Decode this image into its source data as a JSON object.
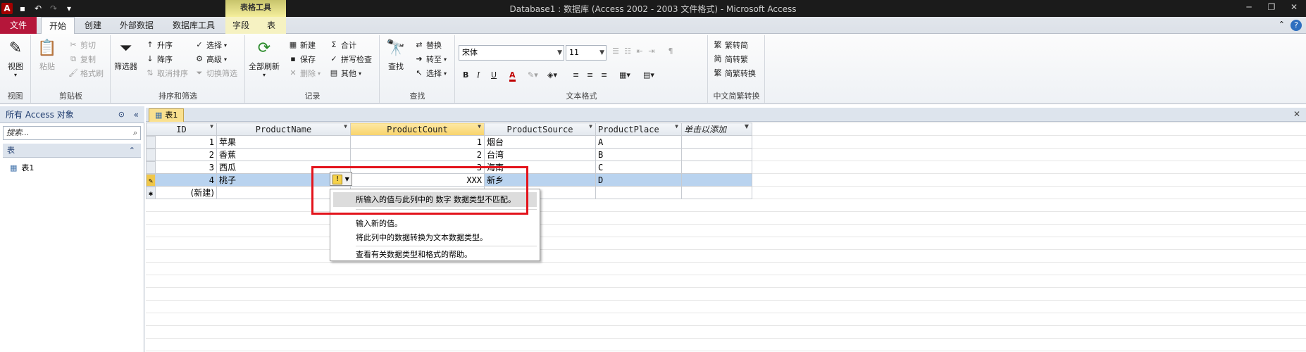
{
  "window": {
    "title": "Database1 : 数据库 (Access 2002 - 2003 文件格式) - Microsoft Access",
    "context_tool": "表格工具"
  },
  "quick_access": {
    "app_icon": "A",
    "icons": [
      "save-icon",
      "undo-icon",
      "redo-icon",
      "customize-icon"
    ]
  },
  "tabs": [
    "文件",
    "开始",
    "创建",
    "外部数据",
    "数据库工具",
    "字段",
    "表"
  ],
  "ribbon": {
    "view": {
      "label": "视图",
      "group": "视图"
    },
    "clipboard": {
      "paste": "粘贴",
      "cut": "剪切",
      "copy": "复制",
      "format_painter": "格式刷",
      "group": "剪贴板"
    },
    "sort": {
      "filter": "筛选器",
      "asc": "升序",
      "desc": "降序",
      "remove_sort": "取消排序",
      "selection": "选择",
      "advanced": "高级",
      "toggle_filter": "切换筛选",
      "group": "排序和筛选"
    },
    "records": {
      "refresh": "全部刷新",
      "new": "新建",
      "save": "保存",
      "delete": "删除",
      "totals": "合计",
      "spelling": "拼写检查",
      "more": "其他",
      "group": "记录"
    },
    "find": {
      "find": "查找",
      "replace": "替换",
      "goto": "转至",
      "select": "选择",
      "group": "查找"
    },
    "text_format": {
      "font": "宋体",
      "size": "11",
      "bold": "B",
      "italic": "I",
      "underline": "U",
      "group": "文本格式"
    },
    "chinese": {
      "t2s": "繁转简",
      "s2t": "简转繁",
      "convert": "简繁转换",
      "group": "中文简繁转换"
    }
  },
  "nav": {
    "header": "所有 Access 对象",
    "search_placeholder": "搜索...",
    "group": "表",
    "item": "表1"
  },
  "doc": {
    "tab": "表1"
  },
  "table": {
    "columns": [
      "ID",
      "ProductName",
      "ProductCount",
      "ProductSource",
      "ProductPlace",
      "单击以添加"
    ],
    "rows": [
      [
        "1",
        "苹果",
        "1",
        "烟台",
        "A"
      ],
      [
        "2",
        "香蕉",
        "2",
        "台湾",
        "B"
      ],
      [
        "3",
        "西瓜",
        "3",
        "海南",
        "C"
      ],
      [
        "4",
        "桃子",
        "XXX",
        "新乡",
        "D"
      ]
    ],
    "new_row": "(新建)"
  },
  "error_popup": {
    "message": "所输入的值与此列中的 数字 数据类型不匹配。",
    "opt1": "输入新的值。",
    "opt2": "将此列中的数据转换为文本数据类型。",
    "opt3": "查看有关数据类型和格式的帮助。"
  },
  "colors": {
    "file_tab": "#b5163a",
    "highlight_box": "#e3141c",
    "active_col": "#f8d36a",
    "current_row": "#b9d3ef"
  }
}
